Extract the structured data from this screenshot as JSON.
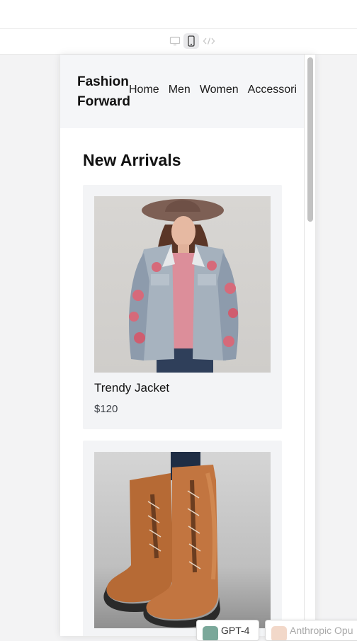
{
  "toolbar": {
    "buttons": [
      {
        "icon": "desktop-icon",
        "active": false
      },
      {
        "icon": "mobile-icon",
        "active": true
      },
      {
        "icon": "code-icon",
        "active": false
      }
    ]
  },
  "site": {
    "brand": "Fashion Forward",
    "nav": [
      "Home",
      "Men",
      "Women",
      "Accessori"
    ]
  },
  "section": {
    "title": "New Arrivals"
  },
  "products": [
    {
      "name": "Trendy Jacket",
      "price": "$120",
      "image": "denim-jacket-photo"
    },
    {
      "name": "",
      "price": "",
      "image": "leather-boots-photo"
    }
  ],
  "models": [
    {
      "label": "GPT-4",
      "icon": "openai-icon",
      "color": "#7aa89a"
    },
    {
      "label": "Anthropic Opu",
      "icon": "anthropic-icon",
      "color": "#f2d8c9"
    }
  ]
}
